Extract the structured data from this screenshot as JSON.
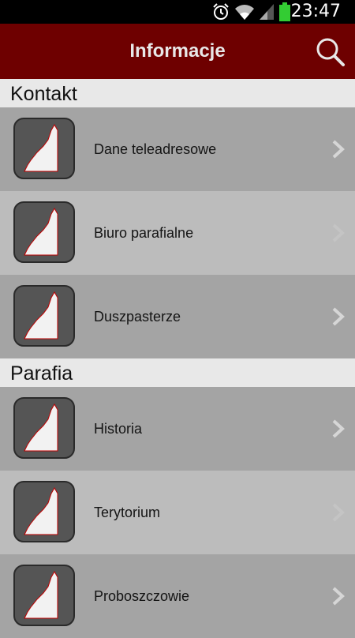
{
  "status_bar": {
    "time": "23:47",
    "icons": [
      "alarm-icon",
      "wifi-icon",
      "signal-icon",
      "battery-icon"
    ],
    "battery_color": "#33cc33"
  },
  "action_bar": {
    "title": "Informacje",
    "background": "#6e0000",
    "search_icon": "search-icon"
  },
  "sections": [
    {
      "title": "Kontakt",
      "items": [
        {
          "label": "Dane teleadresowe"
        },
        {
          "label": "Biuro parafialne"
        },
        {
          "label": "Duszpasterze"
        }
      ]
    },
    {
      "title": "Parafia",
      "items": [
        {
          "label": "Historia"
        },
        {
          "label": "Terytorium"
        },
        {
          "label": "Proboszczowie"
        }
      ]
    }
  ]
}
